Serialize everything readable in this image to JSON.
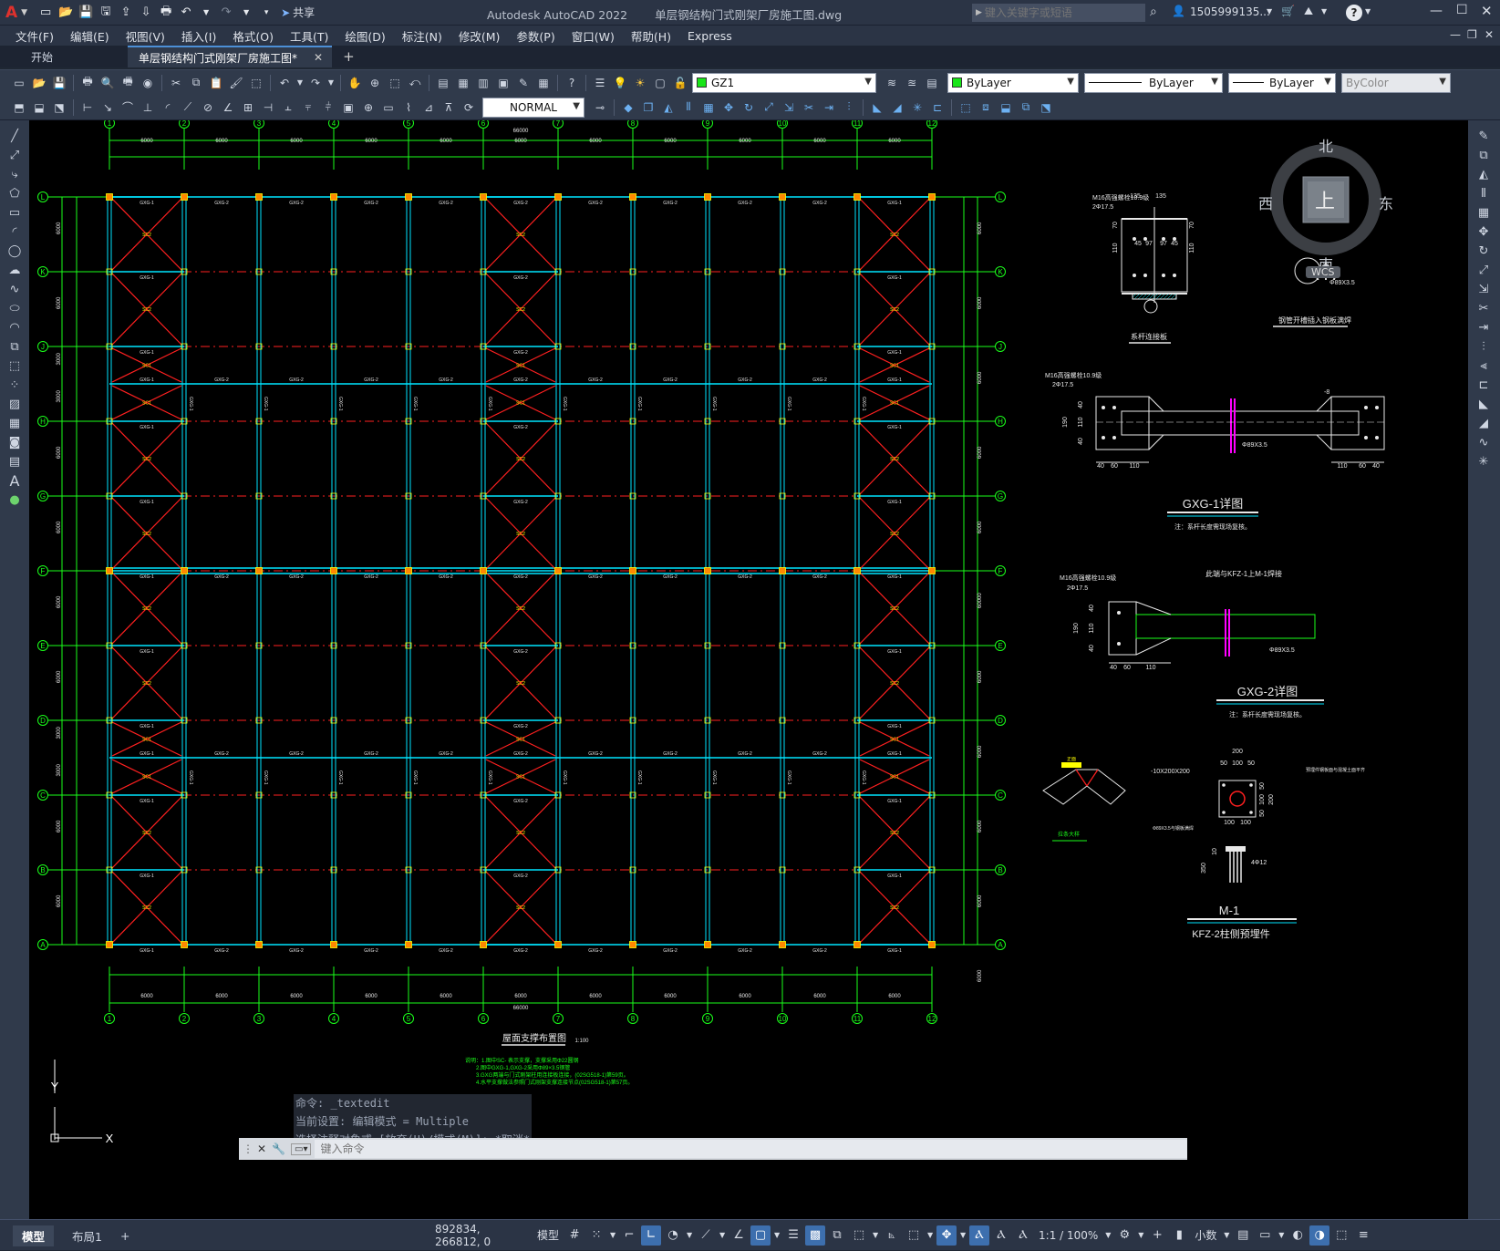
{
  "titlebar": {
    "app_logo": "A",
    "share_label": "共享",
    "app_name": "Autodesk AutoCAD 2022",
    "filename": "单层钢结构门式刚架厂房施工图.dwg",
    "search_placeholder": "键入关键字或短语",
    "user": "1505999135...",
    "help": "?"
  },
  "menu": [
    "文件(F)",
    "编辑(E)",
    "视图(V)",
    "插入(I)",
    "格式(O)",
    "工具(T)",
    "绘图(D)",
    "标注(N)",
    "修改(M)",
    "参数(P)",
    "窗口(W)",
    "帮助(H)",
    "Express"
  ],
  "tabs": {
    "start": "开始",
    "drawing": "单层钢结构门式刚架厂房施工图*",
    "add": "+"
  },
  "toolbar": {
    "layer": "GZ1",
    "color": "ByLayer",
    "linetype": "ByLayer",
    "lineweight": "ByLayer",
    "plotstyle": "ByColor",
    "textstyle": "NORMAL"
  },
  "viewcube": {
    "north": "北",
    "south": "南",
    "east": "东",
    "west": "西",
    "top": "上",
    "wcs": "WCS"
  },
  "command": {
    "history": [
      "命令: _textedit",
      "当前设置: 编辑模式 = Multiple",
      "选择注释对象或 [放弃(U)/模式(M)]: *取消*"
    ],
    "placeholder": "键入命令"
  },
  "layout_tabs": {
    "model": "模型",
    "layout1": "布局1",
    "add": "+"
  },
  "status": {
    "coords": "892834, 266812, 0",
    "space": "模型",
    "scale": "1:1 / 100%",
    "units": "小数"
  },
  "drawing": {
    "col_labels": [
      "1",
      "2",
      "3",
      "4",
      "5",
      "6",
      "7",
      "8",
      "9",
      "10",
      "11",
      "12"
    ],
    "row_labels": [
      "L",
      "K",
      "J",
      "H",
      "G",
      "F",
      "E",
      "D",
      "C",
      "B",
      "A"
    ],
    "bay_dim": "6000",
    "total_dim": "66000",
    "left_dims": [
      "6000",
      "6000",
      "3000",
      "3000",
      "6000",
      "6000",
      "6000",
      "6000",
      "3000",
      "3000",
      "6000",
      "6000"
    ],
    "right_dims": [
      "6000",
      "6000",
      "6000",
      "6000",
      "6000",
      "60000",
      "6000",
      "6000",
      "6000",
      "6000",
      "6000"
    ],
    "plan_title": "屋面支撑布置图",
    "plan_scale": "1:100",
    "member_labels": {
      "gxg1": "GXG-1",
      "gxg2": "GXG-2",
      "sc1": "SC1",
      "sc2": "SC2"
    },
    "notes": [
      "说明：1.图中SC- 表示支撑，支撑采用Φ22圆钢",
      "2.图中GXG-1,GXG-2采用Φ89×3.5钢管",
      "3.GXG两端与门式刚架柱用连接板连接，(02SG518-1)第59页。",
      "4.水平支撑做法参照门式刚架支撑连接节点(02SG518-1)第57页。"
    ],
    "details": {
      "d1_title": "系杆连接板",
      "d1_bolt": "M16高强螺栓10.9级",
      "d1_holes": "2Φ17.5",
      "d1_top": [
        "135",
        "135"
      ],
      "d1_mid": [
        "45",
        "97",
        "97",
        "45"
      ],
      "d1_side": [
        "70",
        "110",
        "70",
        "110"
      ],
      "d1_note": "钢管开槽插入钢板满焊",
      "d1_pipe": "Φ89X3.5",
      "gxg1_title": "GXG-1详图",
      "gxg1_note": "注：系杆长度需现场复核。",
      "gxg1_bolt": "M16高强螺栓10.9级",
      "gxg1_holes": "2Φ17.5",
      "gxg1_plate": "-8",
      "gxg1_pipe": "Φ89X3.5",
      "gxg1_dims_l": [
        "40",
        "60",
        "110"
      ],
      "gxg1_dims_r": [
        "110",
        "60",
        "40"
      ],
      "gxg1_vert": [
        "190",
        "40",
        "110",
        "40"
      ],
      "gxg2_title": "GXG-2详图",
      "gxg2_note": "注：系杆长度需现场复核。",
      "gxg2_bolt": "M16高强螺栓10.9级",
      "gxg2_holes": "2Φ17.5",
      "gxg2_weld": "此端与KFZ-1上M-1焊接",
      "gxg2_pipe": "Φ89X3.5",
      "gxg2_dims": [
        "40",
        "60",
        "110"
      ],
      "gxg2_vert": [
        "190",
        "40",
        "110",
        "40"
      ],
      "m1_title": "M-1",
      "m1_sub": "KFZ-2柱侧预埋件",
      "m1_plate": "-10X200X200",
      "m1_dims_top": [
        "200",
        "50",
        "100",
        "50"
      ],
      "m1_dims_bot": [
        "100",
        "100"
      ],
      "m1_side": [
        "50",
        "100",
        "50",
        "200"
      ],
      "m1_pipe": "Φ89X3.5与钢板满焊",
      "m1_anchor": "4Φ12",
      "m1_anchor_dims": [
        "350",
        "10"
      ],
      "brace_label": "拉条大样",
      "brace_top": "正面",
      "m1_note": "预埋件钢板面与混凝土面平齐"
    }
  }
}
